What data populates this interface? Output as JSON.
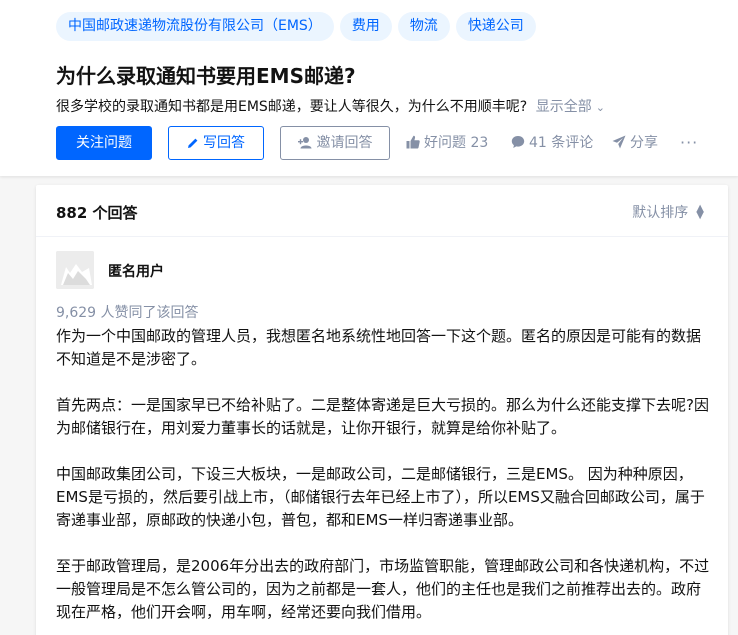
{
  "question": {
    "topics": [
      "中国邮政速递物流股份有限公司（EMS）",
      "费用",
      "物流",
      "快递公司"
    ],
    "title": "为什么录取通知书要用EMS邮递?",
    "detail": "很多学校的录取通知书都是用EMS邮递，要让人等很久，为什么不用顺丰呢?",
    "show_all": "显示全部",
    "follow_label": "关注问题",
    "write_label": "写回答",
    "invite_label": "邀请回答",
    "good_question": "好问题 23",
    "comments": "41 条评论",
    "share": "分享",
    "more": "···"
  },
  "answers": {
    "count_label": "882 个回答",
    "sort_label": "默认排序",
    "author_name": "匿名用户",
    "votes_label": "9,629 人赞同了该回答",
    "paragraphs": [
      "作为一个中国邮政的管理人员，我想匿名地系统性地回答一下这个题。匿名的原因是可能有的数据不知道是不是涉密了。",
      "首先两点：一是国家早已不给补贴了。二是整体寄递是巨大亏损的。那么为什么还能支撑下去呢?因为邮储银行在，用刘爱力董事长的话就是，让你开银行，就算是给你补贴了。",
      "中国邮政集团公司，下设三大板块，一是邮政公司，二是邮储银行，三是EMS。 因为种种原因，EMS是亏损的，然后要引战上市，（邮储银行去年已经上市了），所以EMS又融合回邮政公司，属于寄递事业部，原邮政的快递小包，普包，都和EMS一样归寄递事业部。",
      "至于邮政管理局，是2006年分出去的政府部门，市场监管职能，管理邮政公司和各快递机构，不过一般管理局是不怎么管公司的，因为之前都是一套人，他们的主任也是我们之前推荐出去的。政府现在严格，他们开会啊，用车啊，经常还要向我们借用。"
    ]
  },
  "colors": {
    "accent": "#0066ff",
    "tag_bg": "#ebf5ff",
    "muted": "#8590a6"
  }
}
